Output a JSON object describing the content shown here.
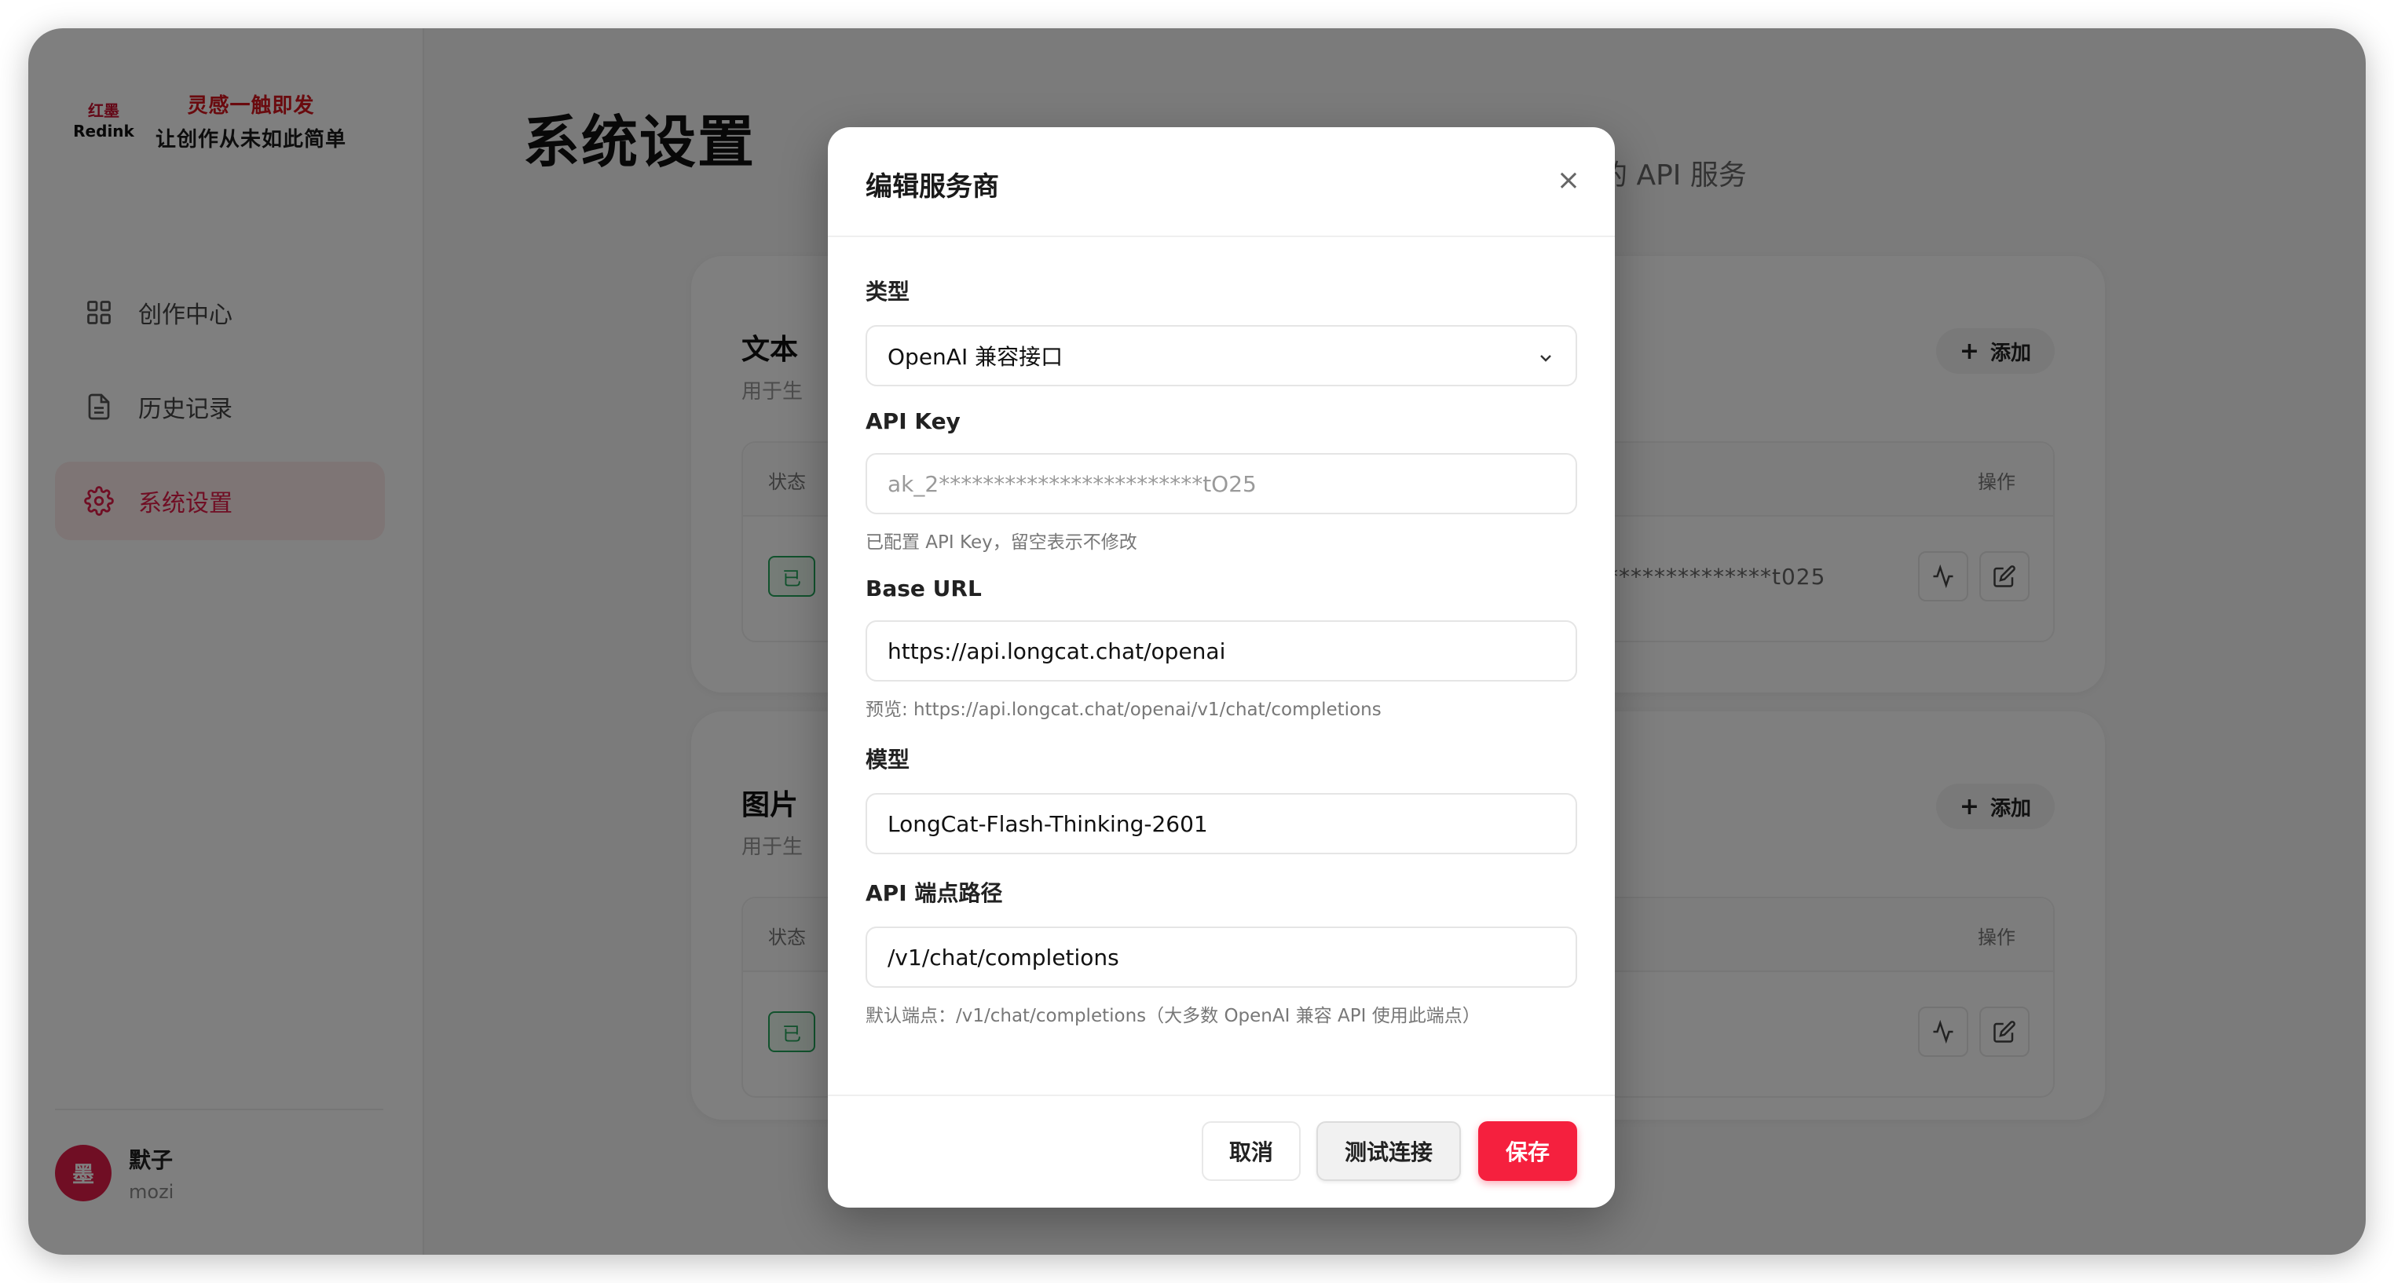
{
  "brand": {
    "logo_line1": "红墨",
    "logo_line2": "Redink",
    "tagline1": "灵感一触即发",
    "tagline2": "让创作从未如此简单"
  },
  "sidebar": {
    "items": [
      {
        "label": "创作中心",
        "icon": "grid-icon"
      },
      {
        "label": "历史记录",
        "icon": "document-icon"
      },
      {
        "label": "系统设置",
        "icon": "gear-icon",
        "active": true
      }
    ]
  },
  "user": {
    "avatar_text": "墨",
    "name": "默子",
    "id": "mozi"
  },
  "page": {
    "title": "系统设置",
    "subtitle_fragment": "成的 API 服务"
  },
  "cards": [
    {
      "title_fragment": "文本",
      "desc_fragment": "用于生",
      "add_label": "添加",
      "header_status": "状态",
      "header_actions": "操作",
      "status_fragment": "已",
      "key_mask": "******************t025"
    },
    {
      "title_fragment": "图片",
      "desc_fragment": "用于生",
      "add_label": "添加",
      "header_status": "状态",
      "header_actions": "操作",
      "status_fragment": "已"
    }
  ],
  "modal": {
    "title": "编辑服务商",
    "close_symbol": "×",
    "type_label": "类型",
    "type_value": "OpenAI 兼容接口",
    "apikey_label": "API Key",
    "apikey_placeholder": "ak_2************************tO25",
    "apikey_hint": "已配置 API Key，留空表示不修改",
    "baseurl_label": "Base URL",
    "baseurl_value": "https://api.longcat.chat/openai",
    "baseurl_hint": "预览: https://api.longcat.chat/openai/v1/chat/completions",
    "model_label": "模型",
    "model_value": "LongCat-Flash-Thinking-2601",
    "endpoint_label": "API 端点路径",
    "endpoint_value": "/v1/chat/completions",
    "endpoint_hint": "默认端点：/v1/chat/completions（大多数 OpenAI 兼容 API 使用此端点）",
    "cancel_label": "取消",
    "test_label": "测试连接",
    "save_label": "保存"
  },
  "colors": {
    "accent": "#f5203e",
    "active_bg": "#fdeaea",
    "success": "#22a55a"
  }
}
